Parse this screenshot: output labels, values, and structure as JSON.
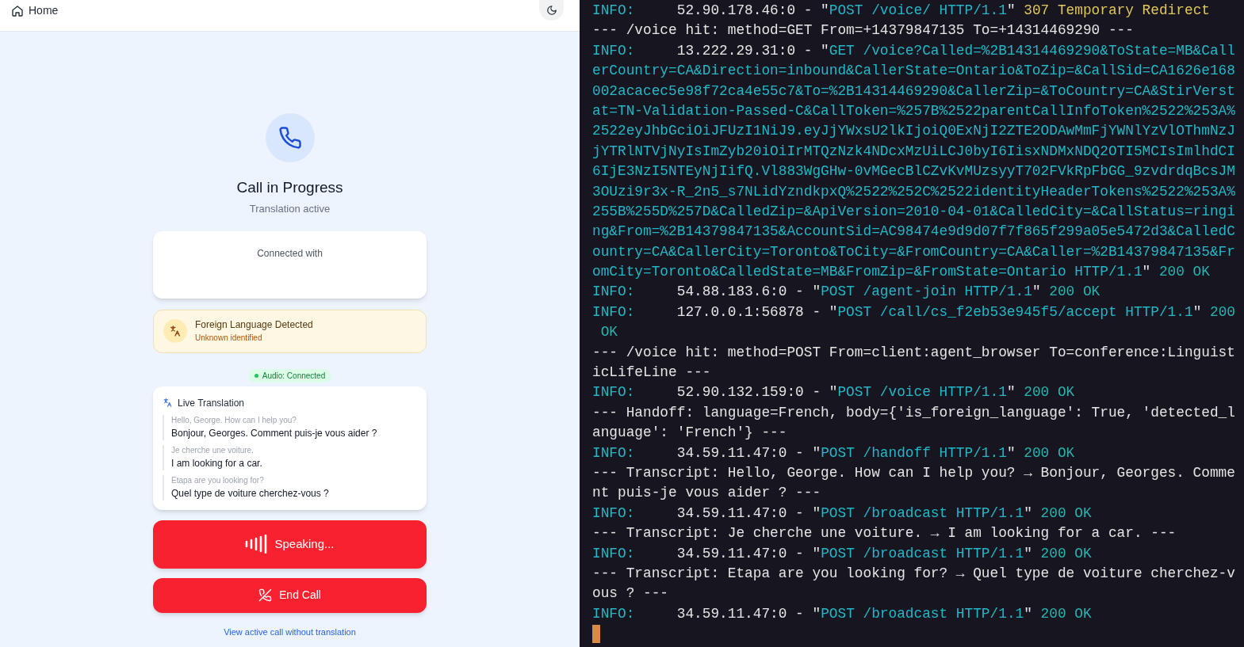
{
  "header": {
    "home_label": "Home"
  },
  "call": {
    "title": "Call in Progress",
    "subtitle": "Translation active",
    "connected_label": "Connected with"
  },
  "language_alert": {
    "title": "Foreign Language Detected",
    "subtitle": "Unknown identified"
  },
  "audio_status": {
    "label": "Audio: Connected",
    "color": "#22c55e"
  },
  "live_translation": {
    "title": "Live Translation",
    "entries": [
      {
        "original": "Hello, George. How can I help you?",
        "translated": "Bonjour, Georges. Comment puis-je vous aider ?"
      },
      {
        "original": "Je cherche une voiture.",
        "translated": "I am looking for a car."
      },
      {
        "original": "Etapa are you looking for?",
        "translated": "Quel type de voiture cherchez-vous ?"
      }
    ]
  },
  "speaking_button": {
    "label": "Speaking..."
  },
  "end_call_button": {
    "label": "End Call"
  },
  "link": {
    "label": "View active call without translation"
  },
  "terminal": {
    "lines": [
      [
        {
          "kind": "info",
          "text": "INFO:"
        },
        {
          "kind": "plain",
          "text": "     52.90.178.46:0 - \""
        },
        {
          "kind": "request",
          "text": "POST /voice/ HTTP/1.1"
        },
        {
          "kind": "plain",
          "text": "\" "
        },
        {
          "kind": "redirect",
          "text": "307 Temporary Redirect"
        }
      ],
      [
        {
          "kind": "plain",
          "text": "--- /voice hit: method=GET From=+14379847135 To=+14314469290 ---"
        }
      ],
      [
        {
          "kind": "info",
          "text": "INFO:"
        },
        {
          "kind": "plain",
          "text": "     13.222.29.31:0 - \""
        },
        {
          "kind": "request",
          "text": "GET /voice?Called=%2B14314469290&ToState=MB&Call"
        }
      ],
      [
        {
          "kind": "request",
          "text": "erCountry=CA&Direction=inbound&CallerState=Ontario&ToZip=&CallSid=CA1626e168"
        }
      ],
      [
        {
          "kind": "request",
          "text": "002acacec5e98f72ca4e55c7&To=%2B14314469290&CallerZip=&ToCountry=CA&StirVerst"
        }
      ],
      [
        {
          "kind": "request",
          "text": "at=TN-Validation-Passed-C&CallToken=%257B%2522parentCallInfoToken%2522%253A%"
        }
      ],
      [
        {
          "kind": "request",
          "text": "2522eyJhbGciOiJFUzI1NiJ9.eyJjYWxsU2lkIjoiQ0ExNjI2ZTE2ODAwMmFjYWNlYzVlOThmNzJ"
        }
      ],
      [
        {
          "kind": "request",
          "text": "jYTRlNTVjNyIsImZyb20iOiIrMTQzNzk4NDcxMzUiLCJ0byI6IisxNDMxNDQ2OTI5MCIsImlhdCI"
        }
      ],
      [
        {
          "kind": "request",
          "text": "6IjE3NzI5NTEyNjIifQ.Vl883WgGHw-0vMGecBlCZvKvMUzsyyT702FVkRpFbGG_9zvdrdqBcsJM"
        }
      ],
      [
        {
          "kind": "request",
          "text": "3OUzi9r3x-R_2n5_s7NLidYzndkpxQ%2522%252C%2522identityHeaderTokens%2522%253A%"
        }
      ],
      [
        {
          "kind": "request",
          "text": "255B%255D%257D&CalledZip=&ApiVersion=2010-04-01&CalledCity=&CallStatus=ringi"
        }
      ],
      [
        {
          "kind": "request",
          "text": "ng&From=%2B14379847135&AccountSid=AC98474e9d9d07f7f865f299a05e5472d3&CalledC"
        }
      ],
      [
        {
          "kind": "request",
          "text": "ountry=CA&CallerCity=Toronto&ToCity=&FromCountry=CA&Caller=%2B14379847135&Fr"
        }
      ],
      [
        {
          "kind": "request",
          "text": "omCity=Toronto&CalledState=MB&FromZip=&FromState=Ontario HTTP/1.1"
        },
        {
          "kind": "plain",
          "text": "\" "
        },
        {
          "kind": "ok",
          "text": "200 OK"
        }
      ],
      [
        {
          "kind": "info",
          "text": "INFO:"
        },
        {
          "kind": "plain",
          "text": "     54.88.183.6:0 - \""
        },
        {
          "kind": "request",
          "text": "POST /agent-join HTTP/1.1"
        },
        {
          "kind": "plain",
          "text": "\" "
        },
        {
          "kind": "ok",
          "text": "200 OK"
        }
      ],
      [
        {
          "kind": "info",
          "text": "INFO:"
        },
        {
          "kind": "plain",
          "text": "     127.0.0.1:56878 - \""
        },
        {
          "kind": "request",
          "text": "POST /call/cs_f2eb53e945f5/accept HTTP/1.1"
        },
        {
          "kind": "plain",
          "text": "\" "
        },
        {
          "kind": "ok",
          "text": "200"
        }
      ],
      [
        {
          "kind": "ok",
          "text": " OK"
        }
      ],
      [
        {
          "kind": "plain",
          "text": "--- /voice hit: method=POST From=client:agent_browser To=conference:Linguist"
        }
      ],
      [
        {
          "kind": "plain",
          "text": "icLifeLine ---"
        }
      ],
      [
        {
          "kind": "info",
          "text": "INFO:"
        },
        {
          "kind": "plain",
          "text": "     52.90.132.159:0 - \""
        },
        {
          "kind": "request",
          "text": "POST /voice HTTP/1.1"
        },
        {
          "kind": "plain",
          "text": "\" "
        },
        {
          "kind": "ok",
          "text": "200 OK"
        }
      ],
      [
        {
          "kind": "plain",
          "text": "--- Handoff: language=French, body={'is_foreign_language': True, 'detected_l"
        }
      ],
      [
        {
          "kind": "plain",
          "text": "anguage': 'French'} ---"
        }
      ],
      [
        {
          "kind": "info",
          "text": "INFO:"
        },
        {
          "kind": "plain",
          "text": "     34.59.11.47:0 - \""
        },
        {
          "kind": "request",
          "text": "POST /handoff HTTP/1.1"
        },
        {
          "kind": "plain",
          "text": "\" "
        },
        {
          "kind": "ok",
          "text": "200 OK"
        }
      ],
      [
        {
          "kind": "plain",
          "text": "--- Transcript: Hello, George. How can I help you? → Bonjour, Georges. Comme"
        }
      ],
      [
        {
          "kind": "plain",
          "text": "nt puis-je vous aider ? ---"
        }
      ],
      [
        {
          "kind": "info",
          "text": "INFO:"
        },
        {
          "kind": "plain",
          "text": "     34.59.11.47:0 - \""
        },
        {
          "kind": "request",
          "text": "POST /broadcast HTTP/1.1"
        },
        {
          "kind": "plain",
          "text": "\" "
        },
        {
          "kind": "ok",
          "text": "200 OK"
        }
      ],
      [
        {
          "kind": "plain",
          "text": "--- Transcript: Je cherche une voiture. → I am looking for a car. ---"
        }
      ],
      [
        {
          "kind": "info",
          "text": "INFO:"
        },
        {
          "kind": "plain",
          "text": "     34.59.11.47:0 - \""
        },
        {
          "kind": "request",
          "text": "POST /broadcast HTTP/1.1"
        },
        {
          "kind": "plain",
          "text": "\" "
        },
        {
          "kind": "ok",
          "text": "200 OK"
        }
      ],
      [
        {
          "kind": "plain",
          "text": "--- Transcript: Etapa are you looking for? → Quel type de voiture cherchez-v"
        }
      ],
      [
        {
          "kind": "plain",
          "text": "ous ? ---"
        }
      ],
      [
        {
          "kind": "info",
          "text": "INFO:"
        },
        {
          "kind": "plain",
          "text": "     34.59.11.47:0 - \""
        },
        {
          "kind": "request",
          "text": "POST /broadcast HTTP/1.1"
        },
        {
          "kind": "plain",
          "text": "\" "
        },
        {
          "kind": "ok",
          "text": "200 OK"
        }
      ]
    ]
  }
}
